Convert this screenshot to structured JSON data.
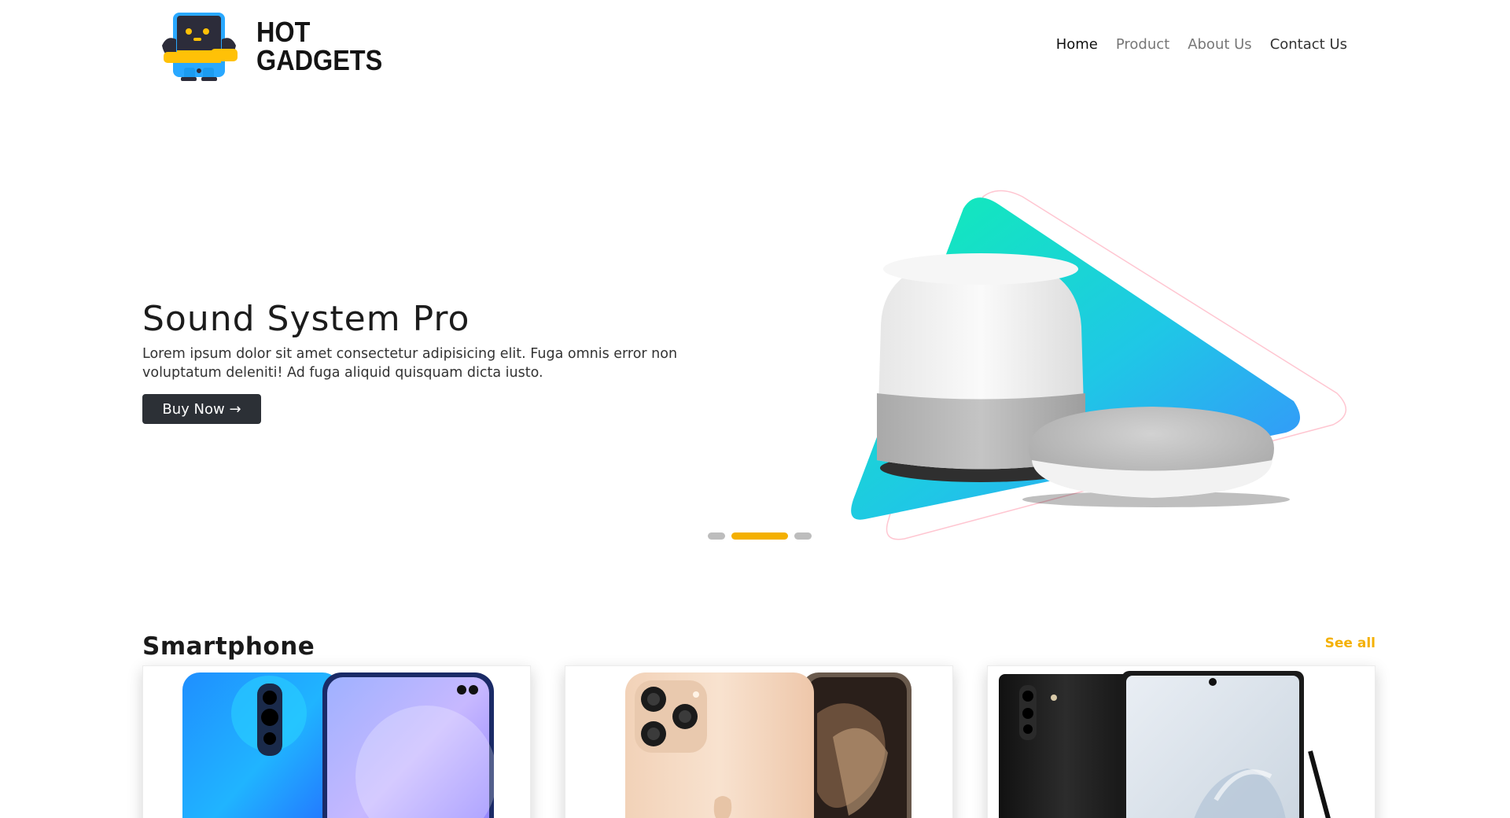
{
  "header": {
    "logo": {
      "line1": "HOT",
      "line2": "GADGETS"
    },
    "nav": [
      {
        "label": "Home",
        "active": true
      },
      {
        "label": "Product",
        "active": false
      },
      {
        "label": "About Us",
        "active": false
      },
      {
        "label": "Contact Us",
        "active": false
      }
    ]
  },
  "hero": {
    "title": "Sound System Pro",
    "description": "Lorem ipsum dolor sit amet consectetur adipisicing elit. Fuga omnis error non voluptatum deleniti! Ad fuga aliquid quisquam dicta iusto.",
    "button_label": "Buy Now →",
    "carousel": {
      "total": 3,
      "active_index": 2
    }
  },
  "section": {
    "title": "Smartphone",
    "see_all": "See all"
  },
  "products": [
    {
      "image": "blue-android-phone"
    },
    {
      "image": "gold-iphone"
    },
    {
      "image": "black-samsung-note"
    }
  ],
  "colors": {
    "accent": "#f4b000",
    "button_bg": "#2c3036",
    "gradient_start": "#0ff0b3",
    "gradient_end": "#3a8bff"
  }
}
